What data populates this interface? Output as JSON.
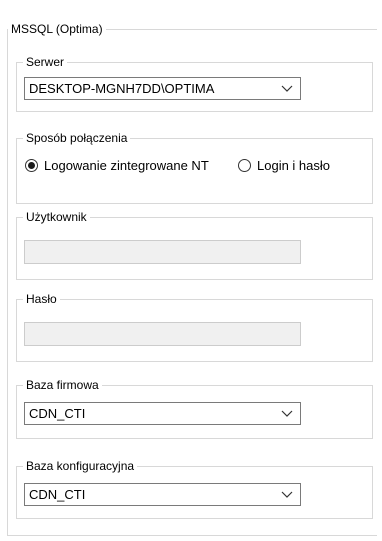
{
  "panel": {
    "title": "MSSQL (Optima)"
  },
  "server": {
    "label": "Serwer",
    "value": "DESKTOP-MGNH7DD\\OPTIMA"
  },
  "connection": {
    "label": "Sposób połączenia",
    "options": [
      {
        "label": "Logowanie zintegrowane NT",
        "selected": true
      },
      {
        "label": "Login i hasło",
        "selected": false
      }
    ]
  },
  "user": {
    "label": "Użytkownik",
    "value": ""
  },
  "password": {
    "label": "Hasło",
    "value": ""
  },
  "company_db": {
    "label": "Baza firmowa",
    "value": "CDN_CTI"
  },
  "config_db": {
    "label": "Baza konfiguracyjna",
    "value": "CDN_CTI"
  },
  "icons": {
    "dropdown": "chevron-down-icon"
  },
  "colors": {
    "border": "#d8d8d8",
    "disabled_field": "#f0f0f0"
  }
}
